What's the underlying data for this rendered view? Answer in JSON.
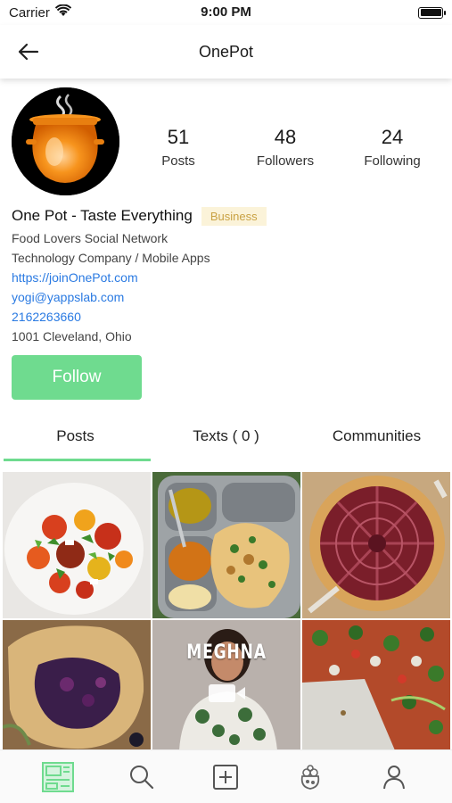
{
  "status_bar": {
    "carrier": "Carrier",
    "time": "9:00 PM"
  },
  "header": {
    "title": "OnePot"
  },
  "profile": {
    "stats": [
      {
        "value": "51",
        "label": "Posts"
      },
      {
        "value": "48",
        "label": "Followers"
      },
      {
        "value": "24",
        "label": "Following"
      }
    ],
    "name": "One Pot - Taste Everything",
    "badge": "Business",
    "tagline": "Food Lovers Social Network",
    "category": "Technology Company / Mobile Apps",
    "website": "https://joinOnePot.com",
    "email": "yogi@yappslab.com",
    "phone": "2162263660",
    "address": "1001 Cleveland, Ohio",
    "follow_label": "Follow"
  },
  "tabs": [
    {
      "label": "Posts"
    },
    {
      "label": "Texts ( 0 )"
    },
    {
      "label": "Communities"
    }
  ],
  "grid": {
    "video_caption": "MEGHNA"
  },
  "bottom_nav": [
    "home-feed-icon",
    "search-icon",
    "add-post-icon",
    "communities-icon",
    "profile-icon"
  ],
  "colors": {
    "accent": "#6fdb8f",
    "link": "#2a7ae2",
    "badge_bg": "#fbf3d9",
    "badge_text": "#c9a244"
  }
}
